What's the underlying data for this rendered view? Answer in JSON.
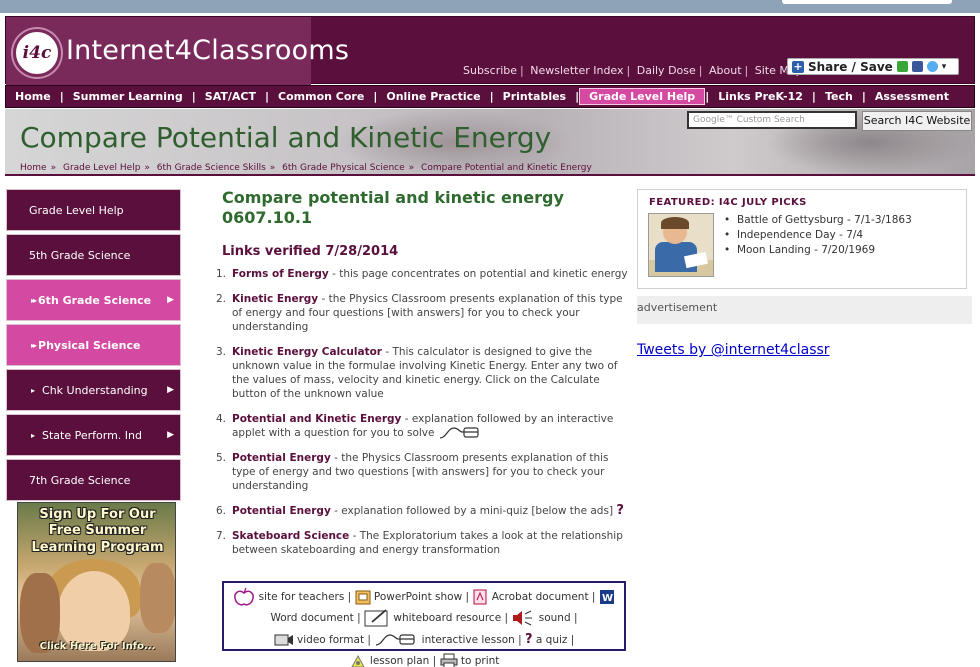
{
  "header": {
    "logo_icon_text": "i4c",
    "logo_text": "Internet4Classrooms",
    "links": [
      "Subscribe",
      "Newsletter Index",
      "Daily Dose",
      "About",
      "Site Map"
    ],
    "share_label": "Share / Save"
  },
  "nav": {
    "items": [
      "Home",
      "Summer Learning",
      "SAT/ACT",
      "Common Core",
      "Online Practice",
      "Printables",
      "Grade Level Help",
      "Links PreK-12",
      "Tech",
      "Assessment"
    ],
    "active": "Grade Level Help"
  },
  "banner": {
    "title": "Compare Potential and Kinetic Energy",
    "breadcrumb": [
      "Home",
      "Grade Level Help",
      "6th Grade Science Skills",
      "6th Grade Physical Science",
      "Compare Potential and Kinetic Energy"
    ],
    "search_placeholder": "Google™ Custom Search",
    "search_button": "Search I4C Website"
  },
  "sidebar": {
    "items": [
      {
        "label": "Grade Level Help",
        "style": "dark"
      },
      {
        "label": "5th Grade Science",
        "style": "dark"
      },
      {
        "label": "6th Grade Science",
        "style": "pink",
        "arrow": "▶"
      },
      {
        "label": "Physical Science",
        "style": "pink"
      },
      {
        "label": "Chk Understanding",
        "style": "dark",
        "arrow": "▶"
      },
      {
        "label": "State Perform. Ind",
        "style": "dark",
        "arrow": "▶"
      },
      {
        "label": "7th Grade Science",
        "style": "dark"
      }
    ],
    "promo": {
      "line1": "Sign Up For Our",
      "line2": "Free Summer",
      "line3": "Learning Program",
      "cta": "Click Here For Info..."
    }
  },
  "main": {
    "heading_line1": "Compare potential and kinetic energy",
    "heading_line2": "0607.10.1",
    "verified": "Links verified 7/28/2014",
    "resources": [
      {
        "num": "1.",
        "title": "Forms of Energy",
        "desc": " - this page concentrates on potential and kinetic energy"
      },
      {
        "num": "2.",
        "title": "Kinetic Energy",
        "desc": " - the Physics Classroom presents explanation of this type of energy and four questions [with answers] for you to check your understanding"
      },
      {
        "num": "3.",
        "title": "Kinetic Energy Calculator",
        "desc": " - This calculator is designed to give the unknown value in the formulae involving Kinetic Energy. Enter any two of the values of mass, velocity and kinetic energy. Click on the Calculate button of the unknown value"
      },
      {
        "num": "4.",
        "title": "Potential and Kinetic Energy",
        "desc": " - explanation followed by an interactive applet with a question for you to solve"
      },
      {
        "num": "5.",
        "title": "Potential Energy",
        "desc": " - the Physics Classroom presents explanation of this type of energy and two questions [with answers] for you to check your understanding"
      },
      {
        "num": "6.",
        "title": "Potential Energy",
        "desc": " - explanation followed by a mini-quiz [below the ads]"
      },
      {
        "num": "7.",
        "title": "Skateboard Science",
        "desc": " - The Exploratorium takes a look at the relationship between skateboarding and energy transformation"
      }
    ]
  },
  "legend": {
    "teachers": "site for teachers",
    "ppt": "PowerPoint show",
    "acrobat": "Acrobat document",
    "word": "Word document",
    "whiteboard": "whiteboard resource",
    "sound": "sound",
    "video": "video format",
    "interactive": "interactive lesson",
    "quiz": "a quiz",
    "lesson": "lesson plan",
    "print": "to print"
  },
  "featured": {
    "title": "FEATURED: I4C JULY PICKS",
    "items": [
      "Battle of Gettysburg - 7/1-3/1863",
      "Independence Day - 7/4",
      "Moon Landing - 7/20/1969"
    ]
  },
  "ad_label": "advertisement",
  "tweets_label": "Tweets by @internet4classr",
  "colors": {
    "brand": "#5a0f3c",
    "accent_pink": "#d44aa2",
    "title_green": "#2f5f2f",
    "link_blue": "#0000cc"
  }
}
